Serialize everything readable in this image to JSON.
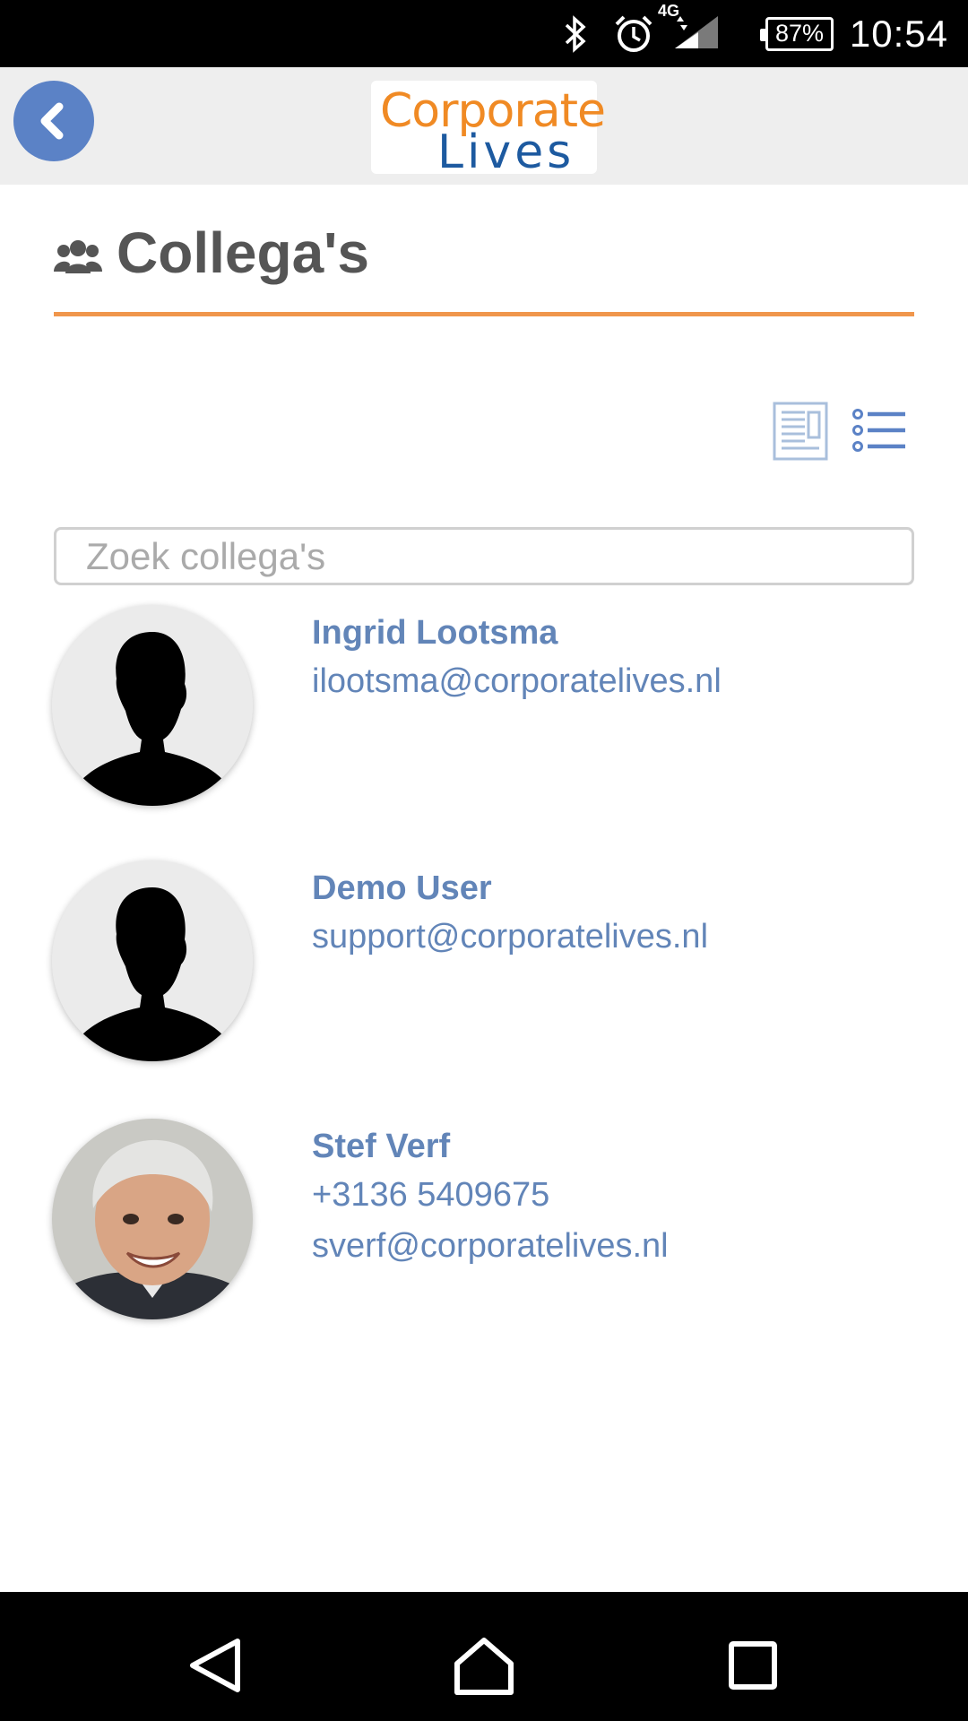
{
  "status_bar": {
    "time": "10:54",
    "battery": "87%",
    "network": "4G",
    "icons": [
      "bluetooth-icon",
      "alarm-icon",
      "signal-icon",
      "battery-icon"
    ]
  },
  "app_bar": {
    "back_icon": "chevron-left-icon",
    "logo_line1": "Corporate",
    "logo_line2": "Lives"
  },
  "page": {
    "title": "Collega's",
    "title_icon": "group-icon"
  },
  "view_toggles": [
    "grid-view-icon",
    "list-view-icon"
  ],
  "search": {
    "placeholder": "Zoek collega's",
    "value": ""
  },
  "contacts": [
    {
      "name": "Ingrid Lootsma",
      "lines": [
        "ilootsma@corporatelives.nl"
      ],
      "avatar": "silhouette"
    },
    {
      "name": "Demo User",
      "lines": [
        "support@corporatelives.nl"
      ],
      "avatar": "silhouette"
    },
    {
      "name": "Stef Verf",
      "lines": [
        "+3136 5409675",
        "sverf@corporatelives.nl"
      ],
      "avatar": "photo"
    }
  ],
  "colors": {
    "accent": "#5b82c6",
    "link": "#6285b8",
    "divider": "#f0964c",
    "logo_orange": "#f08a24",
    "logo_blue": "#1d5aa0"
  },
  "nav_bar": [
    "back-triangle-icon",
    "home-icon",
    "recents-icon"
  ]
}
